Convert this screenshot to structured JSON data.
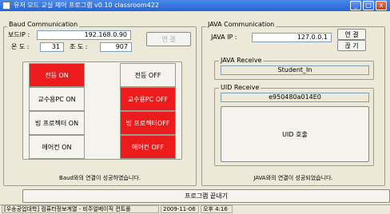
{
  "window": {
    "title": "유저 모드 교실 제어 프로그램 v0.10 classroom422",
    "minimize": "_",
    "maximize": "□",
    "close": "x"
  },
  "baud": {
    "group_title": "Baud Communication",
    "board_ip_label": "보드IP :",
    "board_ip_value": "192.168.0.90",
    "connect_label": "연 결",
    "temp_label": "온 도 :",
    "temp_value": "31",
    "lux_label": "조 도 :",
    "lux_value": "907",
    "status": "Baud와의 연결이 성공하였습니다."
  },
  "controls": [
    {
      "on_label": "전등 ON",
      "off_label": "전등 OFF"
    },
    {
      "on_label": "교수용PC ON",
      "off_label": "교수용PC OFF"
    },
    {
      "on_label": "빔 프로젝터 ON",
      "off_label": "빔 프로젝터OFF"
    },
    {
      "on_label": "에어컨 ON",
      "off_label": "에어컨 OFF"
    }
  ],
  "java": {
    "group_title": "JAVA Communication",
    "ip_label": "JAVA IP :",
    "ip_value": "127.0.0.1",
    "connect_label": "연 결",
    "close_label": "끊 기",
    "receive_title": "JAVA Receive",
    "receive_value": "Student_In",
    "uid_title": "UID Receive",
    "uid_value": "e950480a014E0",
    "uid_button": "UID 호출",
    "status": "JAVA와의 연결이 성공되었습니다."
  },
  "exit_button": "프로그램 끝내기",
  "statusbar": {
    "org": "[우송공업대학] 컴퓨터정보계열 - 비주얼베이직 컨트롤",
    "date": "2009-11-06",
    "time": "오후 4:16"
  },
  "colors": {
    "active": "#ed1c1c",
    "title_bar": "#2563d4"
  }
}
